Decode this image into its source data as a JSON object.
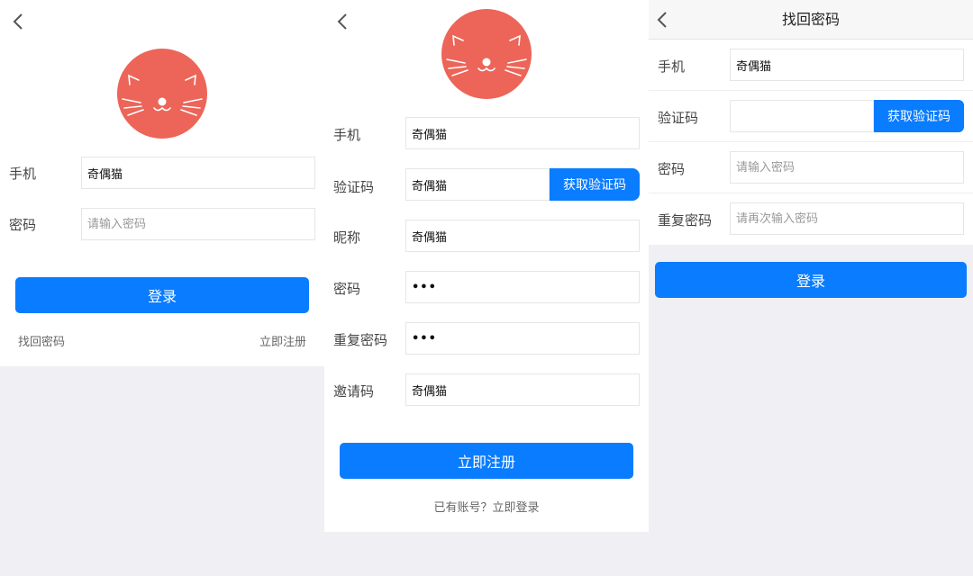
{
  "login": {
    "phone_label": "手机",
    "phone_value": "奇偶猫",
    "password_label": "密码",
    "password_placeholder": "请输入密码",
    "submit": "登录",
    "forgot_link": "找回密码",
    "register_link": "立即注册"
  },
  "register": {
    "phone_label": "手机",
    "phone_value": "奇偶猫",
    "code_label": "验证码",
    "code_value": "奇偶猫",
    "code_button": "获取验证码",
    "nickname_label": "昵称",
    "nickname_value": "奇偶猫",
    "password_label": "密码",
    "password_value": "•••",
    "repeat_label": "重复密码",
    "repeat_value": "•••",
    "invite_label": "邀请码",
    "invite_value": "奇偶猫",
    "submit": "立即注册",
    "login_link": "已有账号？立即登录"
  },
  "recover": {
    "title": "找回密码",
    "phone_label": "手机",
    "phone_value": "奇偶猫",
    "code_label": "验证码",
    "code_button": "获取验证码",
    "password_label": "密码",
    "password_placeholder": "请输入密码",
    "repeat_label": "重复密码",
    "repeat_placeholder": "请再次输入密码",
    "submit": "登录"
  },
  "icons": {
    "back": "chevron-left-icon",
    "avatar": "cat-face-icon"
  },
  "colors": {
    "accent": "#0a7cff",
    "avatar": "#ec6558",
    "background": "#efeff4"
  }
}
